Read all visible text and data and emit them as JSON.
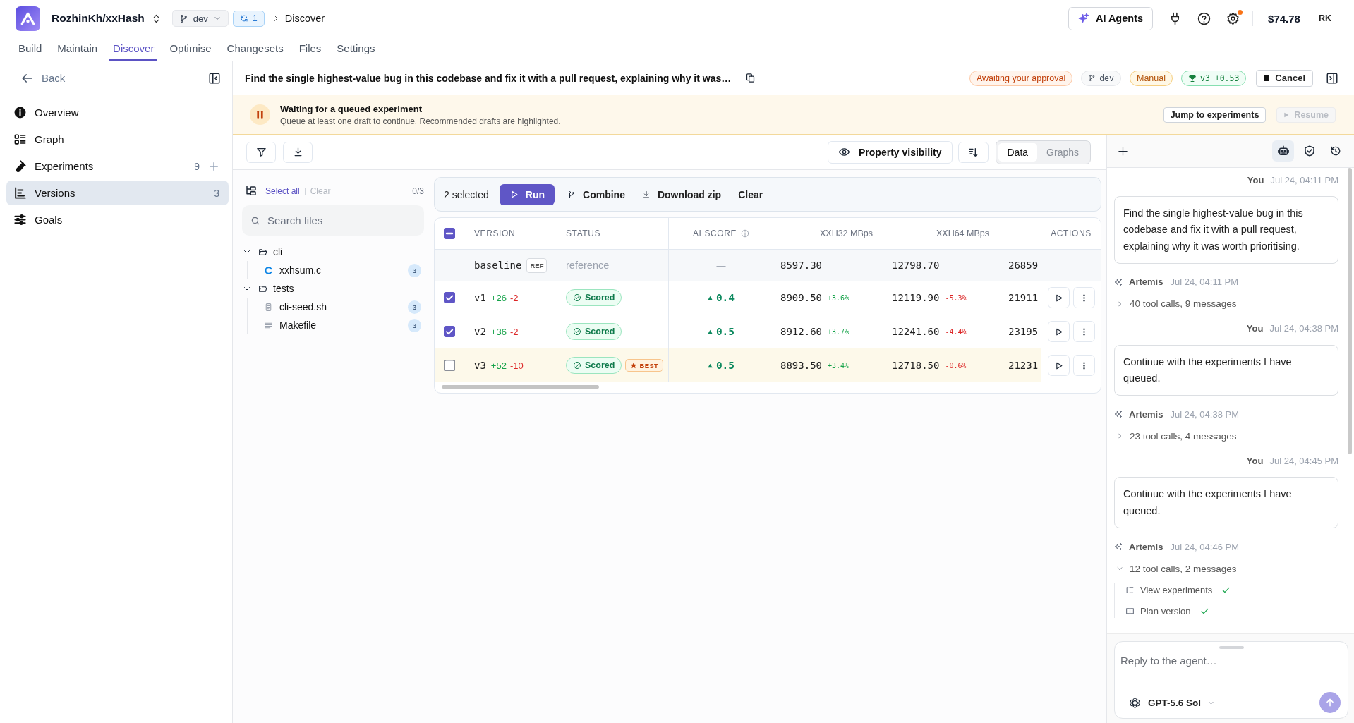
{
  "app": {
    "repo": "RozhinKh/xxHash",
    "branch": "dev",
    "sync_count": "1",
    "breadcrumb": "Discover"
  },
  "header_actions": {
    "agents_button": "AI Agents",
    "settings_notification": true,
    "balance": "$74.78",
    "user_initials": "RK"
  },
  "nav_tabs": [
    {
      "label": "Build",
      "selected": false
    },
    {
      "label": "Maintain",
      "selected": false
    },
    {
      "label": "Discover",
      "selected": true
    },
    {
      "label": "Optimise",
      "selected": false
    },
    {
      "label": "Changesets",
      "selected": false
    },
    {
      "label": "Files",
      "selected": false
    },
    {
      "label": "Settings",
      "selected": false
    }
  ],
  "sidebar": {
    "back": "Back",
    "items": [
      {
        "label": "Overview",
        "selected": false
      },
      {
        "label": "Graph",
        "selected": false
      },
      {
        "label": "Experiments",
        "count": "9",
        "addable": true,
        "selected": false
      },
      {
        "label": "Versions",
        "count": "3",
        "selected": true
      },
      {
        "label": "Goals",
        "selected": false
      }
    ]
  },
  "task": {
    "title": "Find the single highest-value bug in this codebase and fix it with a pull request, explaining why it was…",
    "badges": [
      {
        "kind": "status",
        "label": "Awaiting your approval"
      },
      {
        "kind": "branch",
        "label": "dev"
      },
      {
        "kind": "mode",
        "label": "Manual"
      },
      {
        "kind": "best",
        "label": "v3 +0.53"
      }
    ],
    "cancel": "Cancel"
  },
  "banner": {
    "title": "Waiting for a queued experiment",
    "message": "Queue at least one draft to continue. Recommended drafts are highlighted.",
    "actions": [
      {
        "kind": "jump",
        "label": "Jump to experiments",
        "disabled": false
      },
      {
        "kind": "resume",
        "label": "Resume",
        "disabled": true
      }
    ]
  },
  "toolbar": {
    "property_visibility": "Property visibility",
    "views": [
      {
        "label": "Data",
        "selected": true
      },
      {
        "label": "Graphs",
        "selected": false
      }
    ]
  },
  "files": {
    "select_all": "Select all",
    "clear": "Clear",
    "clear_disabled": true,
    "selected_count": "0/3",
    "search": {
      "placeholder": "Search files"
    },
    "tree": [
      {
        "kind": "folder",
        "name": "cli",
        "expanded": true,
        "children": [
          {
            "kind": "c-source",
            "name": "xxhsum.c",
            "count": "3"
          }
        ]
      },
      {
        "kind": "folder",
        "name": "tests",
        "expanded": true,
        "children": [
          {
            "kind": "script",
            "name": "cli-seed.sh",
            "count": "3"
          },
          {
            "kind": "text",
            "name": "Makefile",
            "count": "3"
          }
        ]
      }
    ]
  },
  "selection_bar": {
    "count": "2 selected",
    "actions": [
      {
        "kind": "run",
        "label": "Run"
      },
      {
        "kind": "combine",
        "label": "Combine"
      },
      {
        "kind": "download",
        "label": "Download zip"
      },
      {
        "kind": "clear",
        "label": "Clear"
      }
    ]
  },
  "table": {
    "select_all": {
      "checked": false,
      "partial": true
    },
    "columns": [
      {
        "label": "VERSION"
      },
      {
        "label": "STATUS"
      },
      {
        "label": "AI SCORE",
        "info": true
      },
      {
        "label": "XXH32 MBps"
      },
      {
        "label": "XXH64 MBps"
      },
      {
        "label": "ACTIONS"
      }
    ],
    "rows": [
      {
        "kind": "baseline",
        "version": "baseline",
        "tag": "REF",
        "status": "reference",
        "ai_score": "—",
        "metrics": [
          {
            "value": "8597.30"
          },
          {
            "value": "12798.70"
          },
          {
            "value": "26859"
          }
        ]
      },
      {
        "kind": "version",
        "checked": true,
        "highlighted": false,
        "version": "v1",
        "added": "+26",
        "removed": "-2",
        "status": "Scored",
        "ai_score": "0.4",
        "score_up": true,
        "metrics": [
          {
            "value": "8909.50",
            "delta": "+3.6%",
            "positive": true
          },
          {
            "value": "12119.90",
            "delta": "-5.3%",
            "positive": false
          },
          {
            "value": "21911"
          }
        ]
      },
      {
        "kind": "version",
        "checked": true,
        "highlighted": false,
        "version": "v2",
        "added": "+36",
        "removed": "-2",
        "status": "Scored",
        "ai_score": "0.5",
        "score_up": true,
        "metrics": [
          {
            "value": "8912.60",
            "delta": "+3.7%",
            "positive": true
          },
          {
            "value": "12241.60",
            "delta": "-4.4%",
            "positive": false
          },
          {
            "value": "23195"
          }
        ]
      },
      {
        "kind": "version",
        "checked": false,
        "highlighted": true,
        "version": "v3",
        "added": "+52",
        "removed": "-10",
        "status": "Scored",
        "badge": "BEST",
        "ai_score": "0.5",
        "score_up": true,
        "metrics": [
          {
            "value": "8893.50",
            "delta": "+3.4%",
            "positive": true
          },
          {
            "value": "12718.50",
            "delta": "-0.6%",
            "positive": false
          },
          {
            "value": "21231"
          }
        ]
      }
    ]
  },
  "chat": {
    "tabs": [
      {
        "kind": "agent",
        "selected": true
      },
      {
        "kind": "checks",
        "selected": false
      },
      {
        "kind": "history",
        "selected": false
      }
    ],
    "messages": [
      {
        "kind": "user",
        "author": "You",
        "time": "Jul 24, 04:11 PM",
        "text": "Find the single highest-value bug in this codebase and fix it with a pull request, explaining why it was worth prioritising."
      },
      {
        "kind": "agent",
        "author": "Artemis",
        "time": "Jul 24, 04:11 PM",
        "summary": "40 tool calls, 9 messages",
        "expanded": false
      },
      {
        "kind": "user",
        "author": "You",
        "time": "Jul 24, 04:38 PM",
        "text": "Continue with the experiments I have queued."
      },
      {
        "kind": "agent",
        "author": "Artemis",
        "time": "Jul 24, 04:38 PM",
        "summary": "23 tool calls, 4 messages",
        "expanded": false
      },
      {
        "kind": "user",
        "author": "You",
        "time": "Jul 24, 04:45 PM",
        "text": "Continue with the experiments I have queued."
      },
      {
        "kind": "agent",
        "author": "Artemis",
        "time": "Jul 24, 04:46 PM",
        "summary": "12 tool calls, 2 messages",
        "expanded": true,
        "tools": [
          {
            "kind": "list",
            "label": "View experiments",
            "done": true
          },
          {
            "kind": "plan",
            "label": "Plan version",
            "done": true
          }
        ]
      }
    ],
    "composer": {
      "placeholder": "Reply to the agent…",
      "model": "GPT-5.6 Sol",
      "send_disabled": true
    }
  }
}
